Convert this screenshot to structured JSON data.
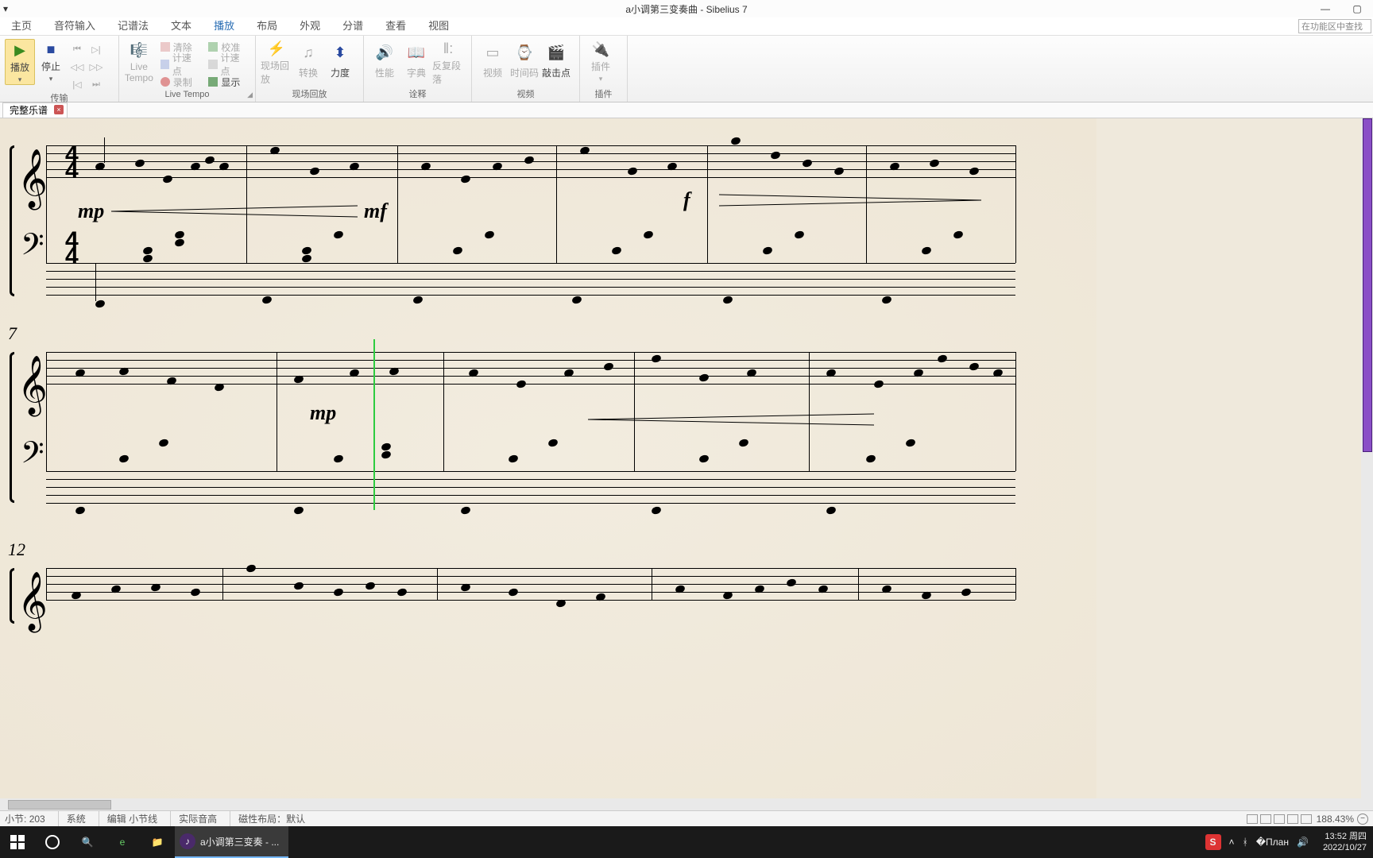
{
  "titlebar": {
    "qa_label": "▾",
    "title": "a小调第三变奏曲 - Sibelius 7",
    "min": "—",
    "max": "▢"
  },
  "tabs": {
    "items": [
      "主页",
      "音符输入",
      "记谱法",
      "文本",
      "播放",
      "布局",
      "外观",
      "分谱",
      "查看",
      "视图"
    ],
    "active_index": 4,
    "search_placeholder": "在功能区中查找"
  },
  "ribbon": {
    "transport": {
      "play": "播放",
      "stop": "停止",
      "label": "传输"
    },
    "livetempo": {
      "big": "Live Tempo",
      "clear": "清除",
      "tap": "计速点",
      "tap2": "计速点",
      "record": "录制",
      "calibrate": "校准",
      "show": "显示",
      "label": "Live Tempo"
    },
    "liveplay": {
      "live_playback": "现场回放",
      "transform": "转换",
      "velocity": "力度",
      "label": "现场回放"
    },
    "interpret": {
      "perf": "性能",
      "dict": "字典",
      "repeats": "反复段落",
      "label": "诠释"
    },
    "video": {
      "video": "视频",
      "timecode": "时间码",
      "hitpoint": "敲击点",
      "label": "视频"
    },
    "plugins": {
      "plugin": "插件",
      "label": "插件"
    }
  },
  "doctab": {
    "name": "完整乐谱"
  },
  "score": {
    "measure_numbers": [
      "7",
      "12"
    ],
    "dynamics": {
      "mp1": "mp",
      "mf": "mf",
      "f": "f",
      "mp2": "mp"
    },
    "time_top": "4",
    "time_bot": "4"
  },
  "status": {
    "bar_label": "小节:",
    "bar_total": "203",
    "system": "系统",
    "edit": "编辑 小节线",
    "pitch": "实际音高",
    "maglayout": "磁性布局：",
    "maglayout_val": "默认",
    "zoom": "188.43%"
  },
  "taskbar": {
    "app": "a小调第三变奏 - ...",
    "ime": "S",
    "time": "13:52",
    "day": "周四",
    "date": "2022/10/27"
  }
}
